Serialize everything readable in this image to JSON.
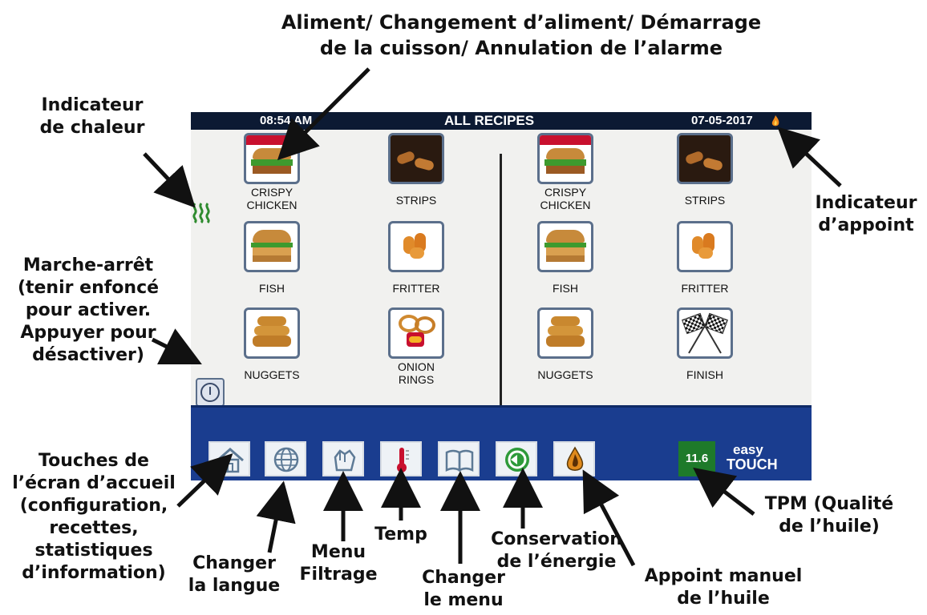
{
  "screen": {
    "time": "08:54 AM",
    "title": "ALL RECIPES",
    "date": "07-05-2017",
    "left_recipes": [
      {
        "label": "CRISPY\nCHICKEN",
        "icon": "burger-icon"
      },
      {
        "label": "STRIPS",
        "icon": "strips-icon"
      },
      {
        "label": "FISH",
        "icon": "fish-sandwich-icon"
      },
      {
        "label": "FRITTER",
        "icon": "fritter-icon"
      },
      {
        "label": "NUGGETS",
        "icon": "nuggets-icon"
      },
      {
        "label": "ONION\nRINGS",
        "icon": "onion-rings-icon"
      }
    ],
    "right_recipes": [
      {
        "label": "CRISPY\nCHICKEN",
        "icon": "burger-icon"
      },
      {
        "label": "STRIPS",
        "icon": "strips-icon"
      },
      {
        "label": "FISH",
        "icon": "fish-sandwich-icon"
      },
      {
        "label": "FRITTER",
        "icon": "fritter-icon"
      },
      {
        "label": "NUGGETS",
        "icon": "nuggets-icon"
      },
      {
        "label": "FINISH",
        "icon": "checkered-flags-icon"
      }
    ],
    "tpm_value": "11.6",
    "brand_line1": "easy",
    "brand_line2": "TOUCH",
    "nav_icons": [
      "home-icon",
      "globe-icon",
      "filter-hand-icon",
      "thermometer-icon",
      "book-icon",
      "energy-icon",
      "oil-drop-icon"
    ],
    "colors": {
      "topbar": "#0c1a33",
      "bottombar": "#1a3d8f",
      "tpm": "#1e7a2a",
      "heat": "#2e8b2e"
    }
  },
  "annotations": {
    "top": "Aliment/ Changement d’aliment/ Démarrage\nde la cuisson/ Annulation de l’alarme",
    "heat": "Indicateur\nde chaleur",
    "topoff": "Indicateur\nd’appoint",
    "power": "Marche-arrêt\n(tenir enfoncé\npour activer.\nAppuyer pour\ndésactiver)",
    "home": "Touches de\nl’écran d’accueil\n(configuration,\nrecettes,\nstatistiques\nd’information)",
    "language": "Changer\nla langue",
    "filter": "Menu\nFiltrage",
    "temp": "Temp",
    "menu": "Changer\nle menu",
    "energy": "Conservation\nde l’énergie",
    "oil": "Appoint manuel\nde l’huile",
    "tpm": "TPM (Qualité\nde l’huile)"
  }
}
